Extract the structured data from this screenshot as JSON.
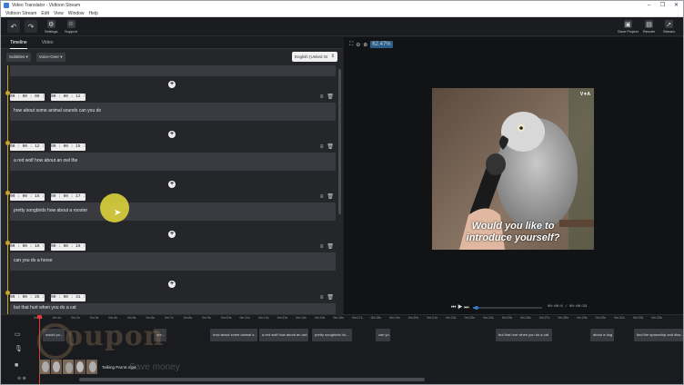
{
  "window": {
    "title": "Video Translator - Vidtoon Stream",
    "controls": [
      "–",
      "❐",
      "✕"
    ]
  },
  "menu": [
    "Vidtoon Stream",
    "Edit",
    "View",
    "Window",
    "Help"
  ],
  "toolbar": {
    "settings": "Settings",
    "support": "Support",
    "save_project": "Save Project",
    "render": "Render",
    "stream": "Stream"
  },
  "left_tabs": [
    "Timeline",
    "Video"
  ],
  "filters": {
    "subtitles": "Subtitles ▾",
    "voice_over": "Voice-Over ▾"
  },
  "language": "English (United St",
  "segments": [
    {
      "start": "00 : 00 : 09 : 78",
      "end": "00 : 00 : 12 : 46",
      "text": "how about some animal sounds can you do"
    },
    {
      "start": "00 : 00 : 12 : 48",
      "end": "00 : 00 : 15 : 46",
      "text": "a red wolf how about an owl the"
    },
    {
      "start": "00 : 00 : 15 : 48",
      "end": "00 : 00 : 17 : 48",
      "text": "pretty songbirds how about a rooster"
    },
    {
      "start": "00 : 00 : 19 : 00",
      "end": "00 : 00 : 19 : 80",
      "text": "can you do a horse"
    },
    {
      "start": "00 : 00 : 25 : 80",
      "end": "00 : 00 : 31 : 20",
      "text": "but that hurt when you do a cat"
    }
  ],
  "preview": {
    "zoom": "62.47%",
    "caption_line1": "Would you like to",
    "caption_line2": "introduce yourself?",
    "logo": "V✦A",
    "time": "00:00:0 / 00:00:33",
    "progress": 0.05
  },
  "timeline": {
    "ticks": [
      "0m:0s",
      "0m:1s",
      "0m:2s",
      "0m:3s",
      "0m:4s",
      "0m:5s",
      "0m:6s",
      "0m:7s",
      "0m:8s",
      "0m:9s",
      "0m:10s",
      "0m:11s",
      "0m:12s",
      "0m:13s",
      "0m:14s",
      "0m:15s",
      "0m:16s",
      "0m:17s",
      "0m:18s",
      "0m:19s",
      "0m:20s",
      "0m:21s",
      "0m:22s",
      "0m:23s",
      "0m:24s",
      "0m:25s",
      "0m:26s",
      "0m:27s",
      "0m:28s",
      "0m:29s",
      "0m:30s",
      "0m:31s",
      "0m:32s",
      "0m:33s"
    ],
    "clips": [
      "would yo...",
      "are...",
      "how about some animal s...",
      "a red wolf how about an owl ...",
      "pretty songbirds ho...",
      "can yo...",
      "but that hurt when you do a cat",
      "about a dog",
      "find the spaceship and diss..."
    ],
    "video_label": "Talking Parrot.mp4"
  },
  "watermark": {
    "brand": "oupon",
    "tagline": "- Save money"
  }
}
